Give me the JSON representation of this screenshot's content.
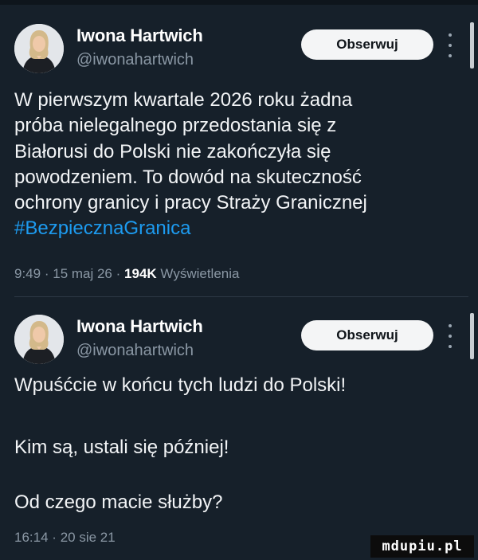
{
  "colors": {
    "background": "#16202a",
    "text": "#f2f4f6",
    "secondary_text": "#8a97a4",
    "hashtag": "#1d9bf0",
    "follow_button_bg": "#f4f5f6"
  },
  "posts": [
    {
      "author": {
        "name": "Iwona Hartwich",
        "handle": "@iwonahartwich"
      },
      "follow_label": "Obserwuj",
      "text_lines": [
        "W pierwszym kwartale 2026 roku żadna",
        "próba nielegalnego przedostania się z",
        "Białorusi do Polski nie zakończyła się",
        "powodzeniem. To dowód na skuteczność",
        "ochrony granicy i pracy Straży Granicznej"
      ],
      "hashtag": "#BezpiecznaGranica",
      "time": "9:49",
      "date": "15 maj 26",
      "views_count": "194K",
      "views_label": "Wyświetlenia",
      "separator": "·"
    },
    {
      "author": {
        "name": "Iwona Hartwich",
        "handle": "@iwonahartwich"
      },
      "follow_label": "Obserwuj",
      "text_lines": [
        "Wpuśćcie w końcu tych ludzi do Polski!",
        "Kim są, ustali się później!",
        "Od czego macie służby?"
      ],
      "time": "16:14",
      "date": "20 sie 21",
      "separator": "·"
    }
  ],
  "watermark": "mdupiu.pl",
  "icons": [
    "more-options-icon",
    "avatar"
  ]
}
